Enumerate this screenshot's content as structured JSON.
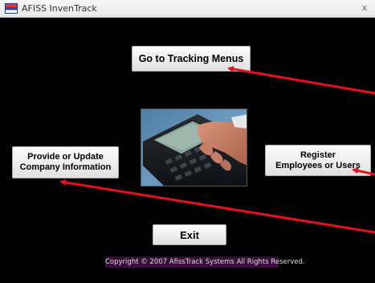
{
  "window": {
    "title": "AFISS InvenTrack",
    "close_glyph": "x"
  },
  "buttons": {
    "tracking": "Go to Tracking Menus",
    "company_line1": "Provide or Update",
    "company_line2": "Company Information",
    "register_line1": "Register",
    "register_line2": "Employees or Users",
    "exit": "Exit"
  },
  "footer": {
    "copyright": "Copyright © 2007 AfissTrack Systems All Rights Reserved."
  },
  "colors": {
    "background": "#000000",
    "arrow": "#e8101a",
    "copyright_bg": "#3a0e3a"
  },
  "icons": {
    "app": "inventrack-app-icon",
    "close": "close-icon"
  }
}
